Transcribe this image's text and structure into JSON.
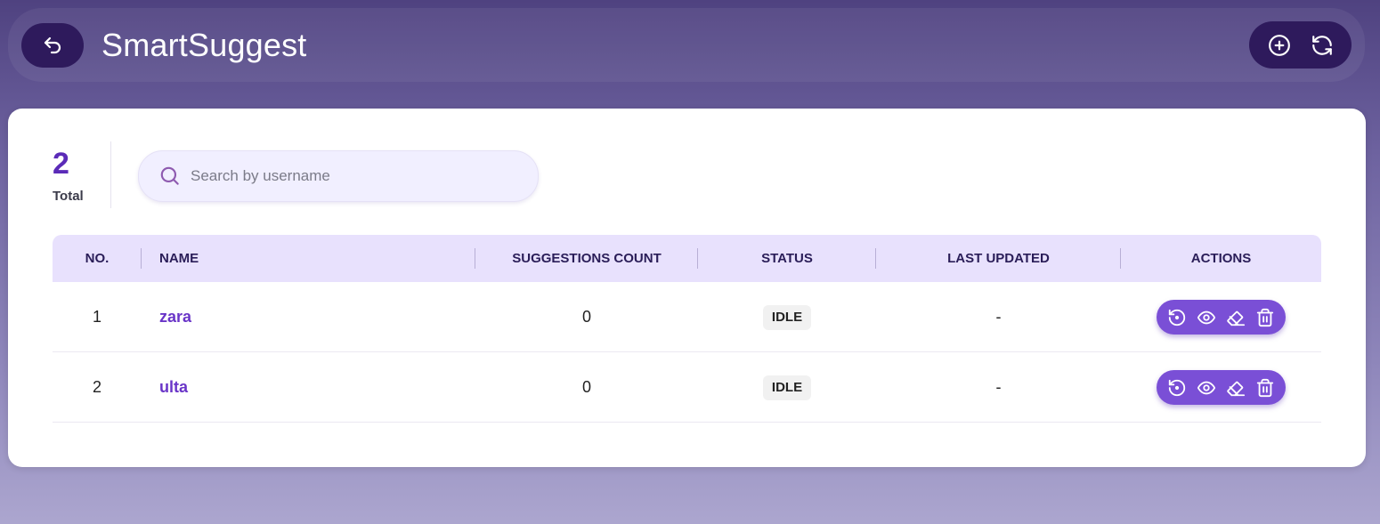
{
  "app": {
    "title": "SmartSuggest"
  },
  "header": {
    "back_icon": "undo-arrow-icon",
    "tools": [
      {
        "name": "add-button",
        "icon": "plus-circle-icon"
      },
      {
        "name": "refresh-button",
        "icon": "refresh-icon"
      }
    ]
  },
  "summary": {
    "total_value": "2",
    "total_label": "Total"
  },
  "search": {
    "placeholder": "Search by username",
    "value": ""
  },
  "table": {
    "columns": [
      "NO.",
      "NAME",
      "SUGGESTIONS COUNT",
      "STATUS",
      "LAST UPDATED",
      "ACTIONS"
    ],
    "rows": [
      {
        "no": "1",
        "name": "zara",
        "suggestions": "0",
        "status": "IDLE",
        "last_updated": "-"
      },
      {
        "no": "2",
        "name": "ulta",
        "suggestions": "0",
        "status": "IDLE",
        "last_updated": "-"
      }
    ],
    "row_action_icons": [
      "reset-icon",
      "eye-icon",
      "eraser-icon",
      "trash-icon"
    ]
  },
  "colors": {
    "accent": "#7a4fd6",
    "header_button": "#2e1a5c",
    "table_header_bg": "#e8e1fd",
    "name_text": "#6a35c8"
  }
}
